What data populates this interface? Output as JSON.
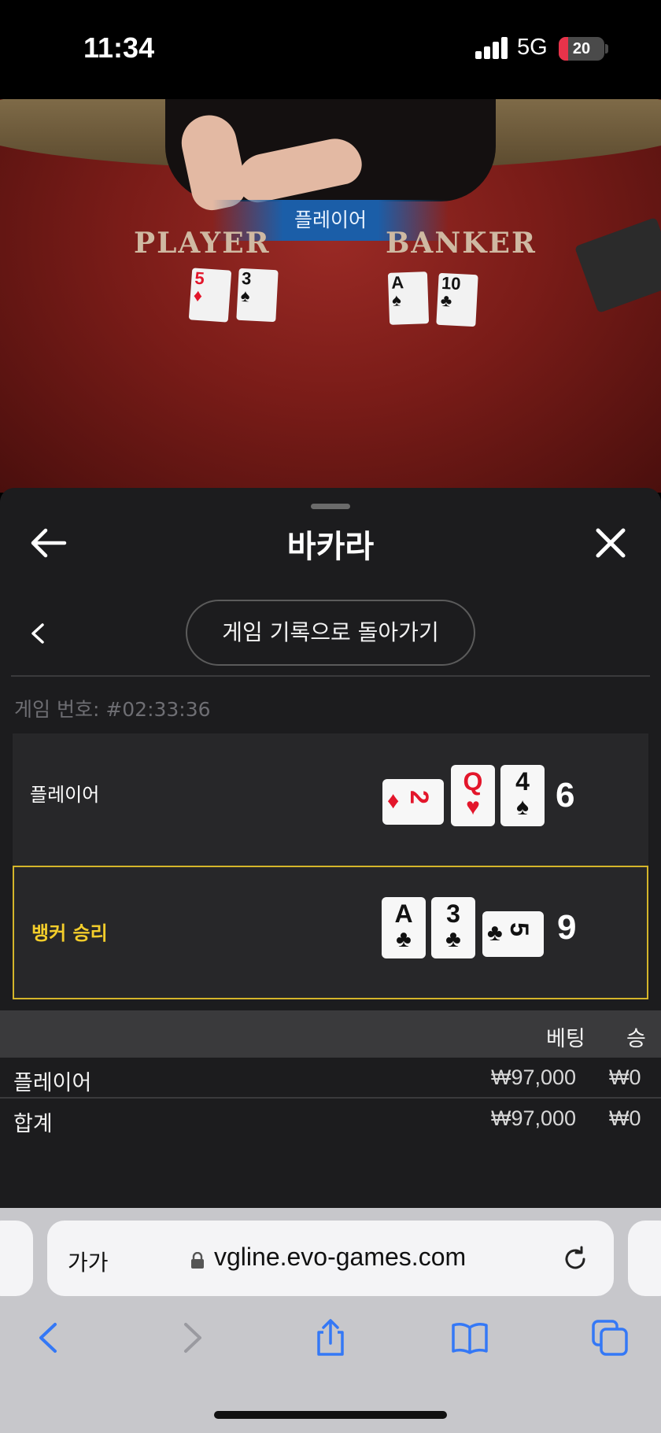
{
  "status_bar": {
    "time": "11:34",
    "network": "5G",
    "battery": "20",
    "battery_fraction": 0.2
  },
  "table_view": {
    "result_banner": "플레이어",
    "player_label": "PLAYER",
    "banker_label": "BANKER",
    "player_cards": [
      {
        "rank": "5",
        "suit": "♦",
        "color": "red"
      },
      {
        "rank": "3",
        "suit": "♠",
        "color": "black"
      }
    ],
    "banker_cards": [
      {
        "rank": "A",
        "suit": "♠",
        "color": "black"
      },
      {
        "rank": "10",
        "suit": "♣",
        "color": "black"
      }
    ]
  },
  "modal": {
    "title": "바카라",
    "back_to_history": "게임 기록으로 돌아가기",
    "game_number": "게임 번호: #02:33:36",
    "player_row": {
      "label": "플레이어",
      "total": "6",
      "cards": [
        {
          "rank": "2",
          "suit": "♦",
          "color": "red",
          "orientation": "sideways"
        },
        {
          "rank": "Q",
          "suit": "♥",
          "color": "red",
          "orientation": "upright"
        },
        {
          "rank": "4",
          "suit": "♠",
          "color": "black",
          "orientation": "upright"
        }
      ]
    },
    "banker_row": {
      "label": "뱅커 승리",
      "total": "9",
      "cards": [
        {
          "rank": "A",
          "suit": "♣",
          "color": "black",
          "orientation": "upright"
        },
        {
          "rank": "3",
          "suit": "♣",
          "color": "black",
          "orientation": "upright"
        },
        {
          "rank": "5",
          "suit": "♣",
          "color": "black",
          "orientation": "sideways"
        }
      ]
    },
    "bets_table": {
      "columns": [
        "베팅",
        "승"
      ],
      "rows": [
        {
          "name": "플레이어",
          "bet": "₩97,000",
          "win": "₩0"
        },
        {
          "name": "합계",
          "bet": "₩97,000",
          "win": "₩0"
        }
      ]
    }
  },
  "browser": {
    "text_size_button": "가가",
    "url": "vgline.evo-games.com",
    "accent_color": "#3478f6"
  }
}
